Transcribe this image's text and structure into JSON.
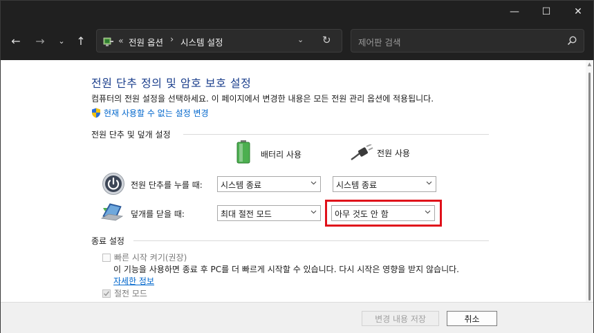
{
  "window": {
    "minimize_glyph": "—",
    "maximize_glyph": "☐",
    "close_glyph": "✕"
  },
  "nav": {
    "back_glyph": "←",
    "forward_glyph": "→",
    "recent_glyph": "⌄",
    "up_glyph": "↑"
  },
  "address": {
    "overflow": "«",
    "crumbs": [
      "전원 옵션",
      "시스템 설정"
    ],
    "separator": "›",
    "dropdown_glyph": "⌄",
    "refresh_glyph": "↻"
  },
  "search": {
    "placeholder": "제어판 검색"
  },
  "page": {
    "title": "전원 단추 정의 및 암호 보호 설정",
    "description": "컴퓨터의 전원 설정을 선택하세요. 이 페이지에서 변경한 내용은 모든 전원 관리 옵션에 적용됩니다.",
    "change_settings_link": "현재 사용할 수 없는 설정 변경"
  },
  "power_section": {
    "title": "전원 단추 및 덮개 설정",
    "battery_header": "배터리 사용",
    "plugged_header": "전원 사용",
    "rows": [
      {
        "label": "전원 단추를 누를 때:",
        "battery_value": "시스템 종료",
        "plugged_value": "시스템 종료"
      },
      {
        "label": "덮개를 닫을 때:",
        "battery_value": "최대 절전 모드",
        "plugged_value": "아무 것도 안 함"
      }
    ]
  },
  "shutdown_section": {
    "title": "종료 설정",
    "fast_startup": {
      "label": "빠른 시작 켜기(권장)",
      "description": "이 기능을 사용하면 종료 후 PC를 더 빠르게 시작할 수 있습니다. 다시 시작은 영향을 받지 않습니다.",
      "more_link": "자세한 정보",
      "checked": false
    },
    "sleep": {
      "label": "절전 모드",
      "checked": true
    }
  },
  "footer": {
    "save_label": "변경 내용 저장",
    "cancel_label": "취소"
  },
  "colors": {
    "title_blue": "#1a3e8c",
    "link_blue": "#0066cc",
    "highlight_red": "#e0101a"
  }
}
